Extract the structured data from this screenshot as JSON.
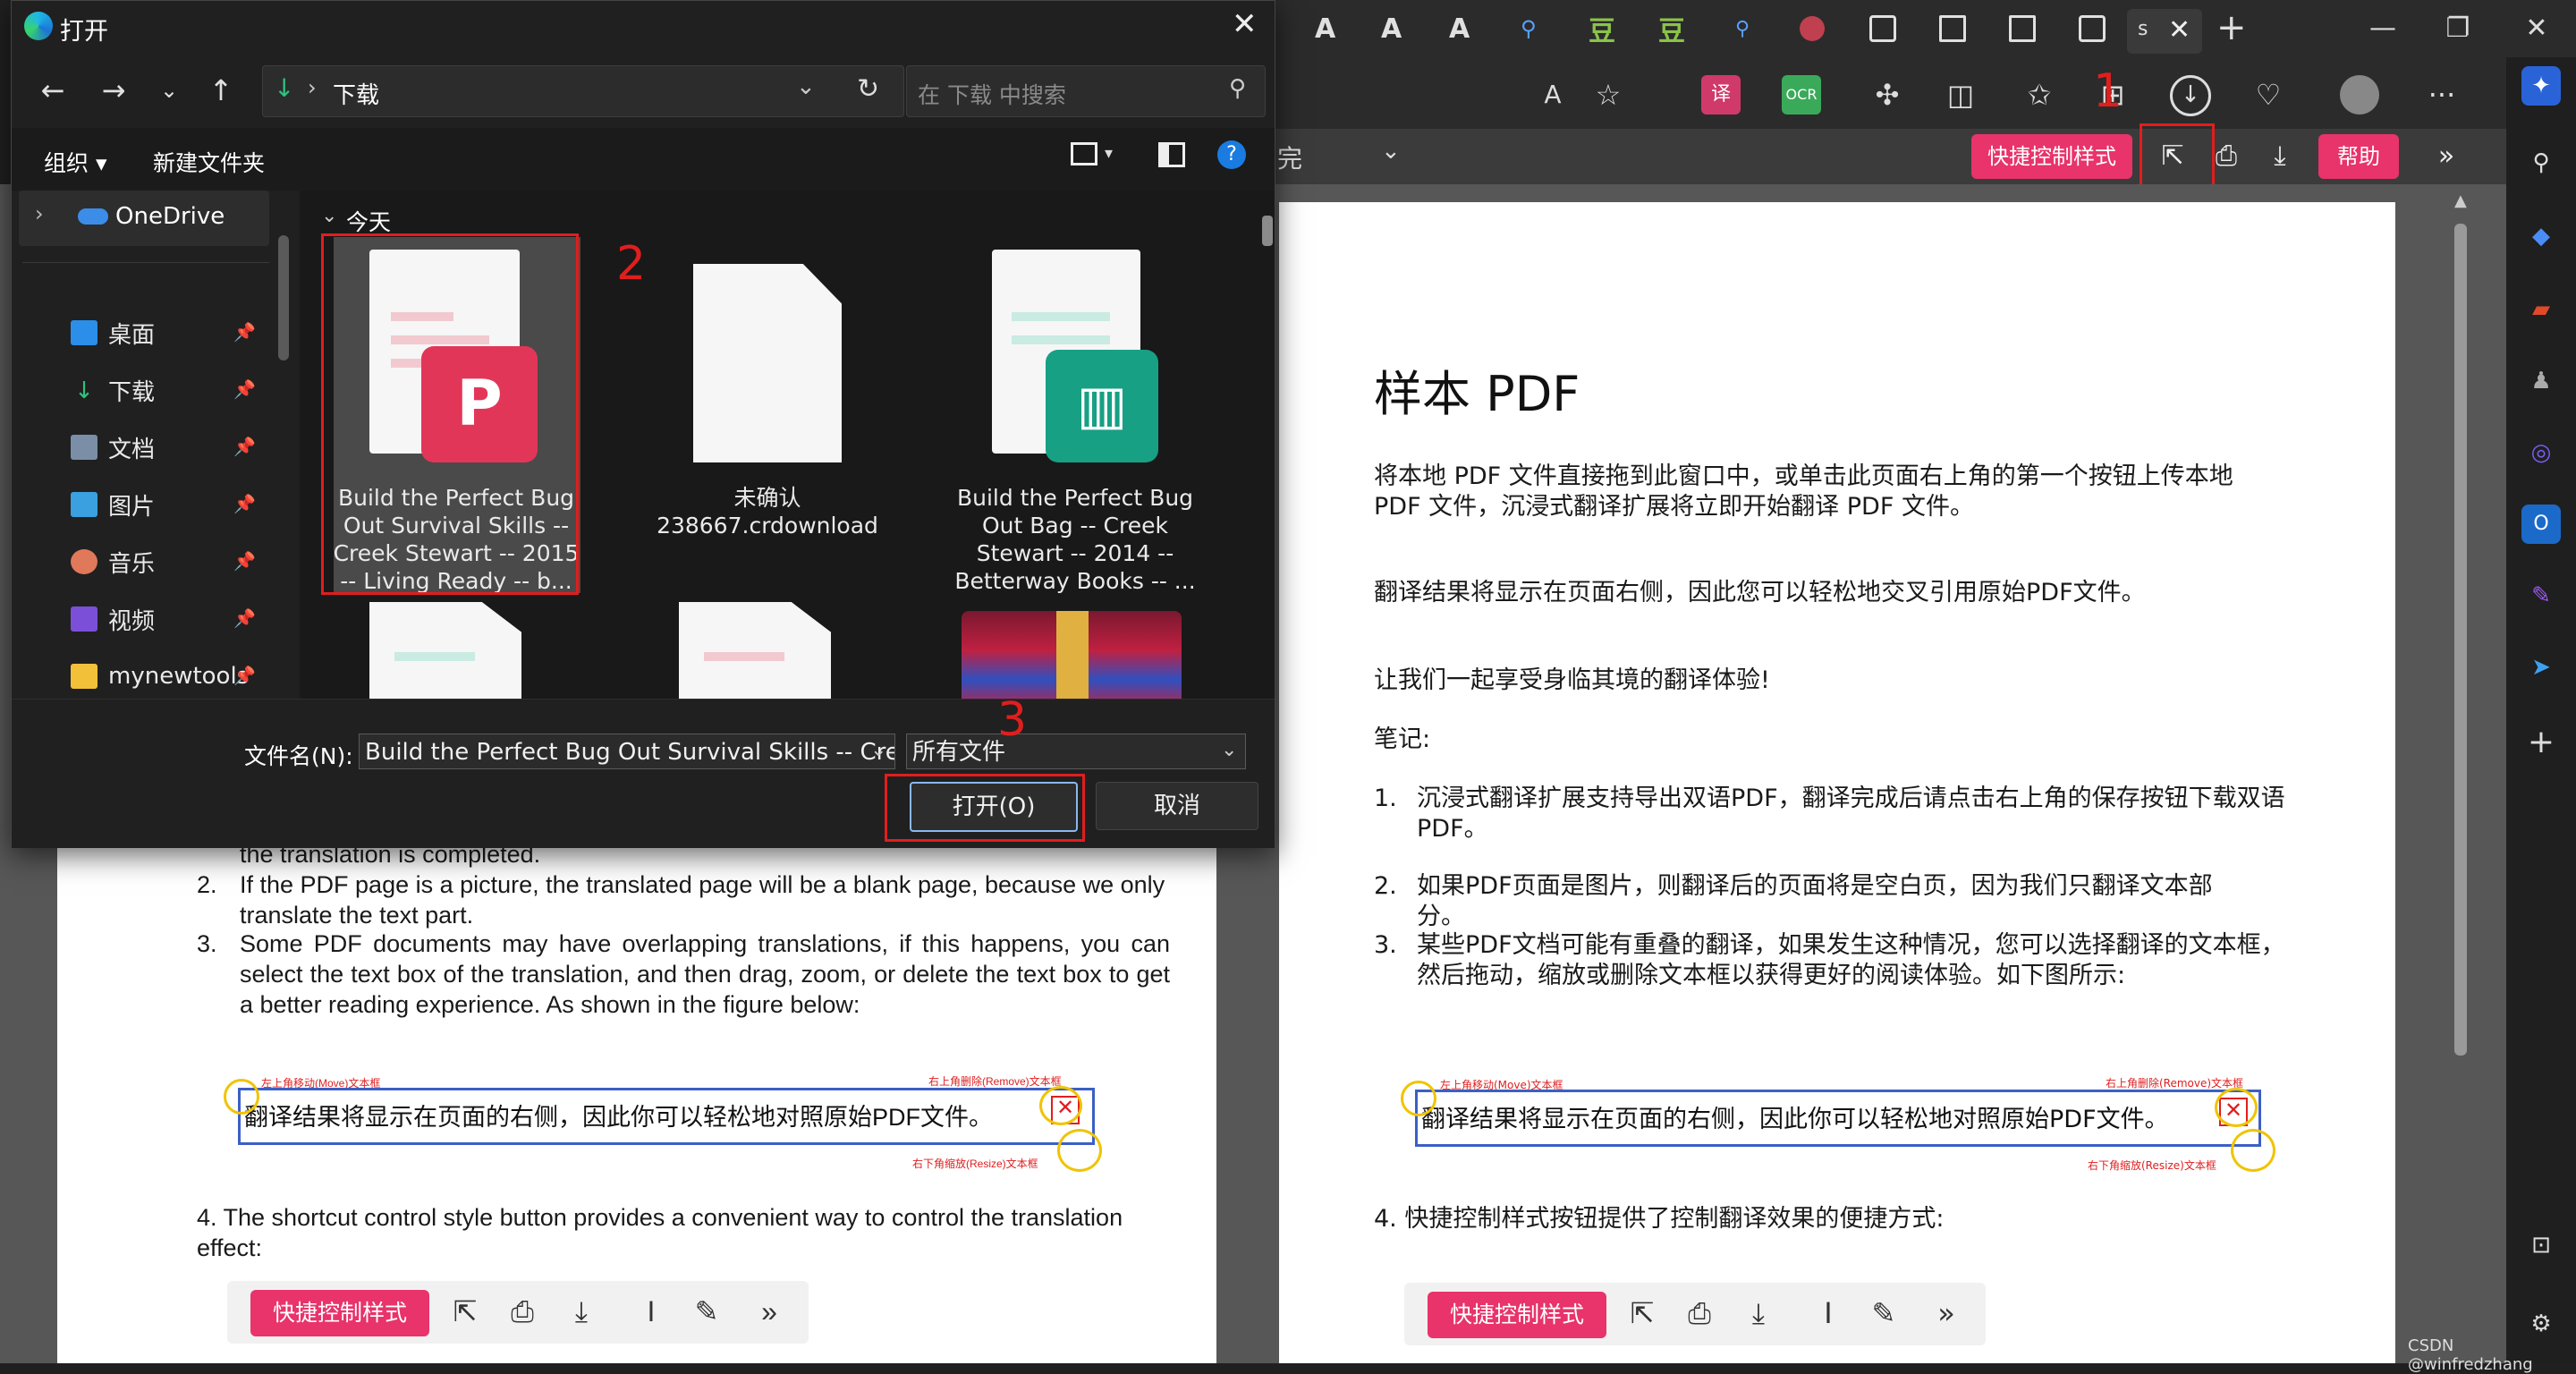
{
  "dialog": {
    "title": "打开",
    "path_label": "下载",
    "search_placeholder": "在 下载 中搜索",
    "cmd": {
      "organize": "组织 ▾",
      "new_folder": "新建文件夹"
    },
    "nav": [
      {
        "label": "OneDrive"
      },
      {
        "label": "桌面"
      },
      {
        "label": "下载"
      },
      {
        "label": "文档"
      },
      {
        "label": "图片"
      },
      {
        "label": "音乐"
      },
      {
        "label": "视频"
      },
      {
        "label": "mynewtools"
      }
    ],
    "group_header": "今天",
    "files": [
      {
        "name": "Build the Perfect Bug Out Survival Skills -- Creek Stewart -- 2015 -- Living Ready -- b..."
      },
      {
        "name": "未确认 238667.crdownload"
      },
      {
        "name": "Build the Perfect Bug Out Bag -- Creek Stewart -- 2014 -- Betterway Books -- ..."
      }
    ],
    "filename_label": "文件名(N):",
    "filename_value": "Build the Perfect Bug Out Survival Skills -- Creek",
    "filetype_value": "所有文件",
    "open_button": "打开(O)",
    "cancel_button": "取消"
  },
  "annotations": {
    "one": "1",
    "two": "2",
    "three": "3"
  },
  "browser": {
    "tab_label": "s",
    "viewer_left_text": "完",
    "shortcut_button": "快捷控制样式",
    "help_button": "帮助"
  },
  "left_pdf": {
    "line0": "the translation is completed.",
    "item2": "If the PDF page is a picture, the translated page will be a blank page, because we only translate the text part.",
    "item3": "Some PDF documents may have overlapping translations, if this happens, you can select the text box of the translation, and then drag, zoom, or delete the text box to get a better reading experience. As shown in the figure below:",
    "demo_text": "翻译结果将显示在页面的右侧，因此你可以轻松地对照原始PDF文件。",
    "demo_move": "左上角移动(Move)文本框",
    "demo_remove": "右上角删除(Remove)文本框",
    "demo_resize": "右下角缩放(Resize)文本框",
    "item4": "4.  The shortcut control style button provides a convenient way to control the translation effect:",
    "shortcut_button": "快捷控制样式"
  },
  "right_pdf": {
    "title": "样本 PDF",
    "p1": "将本地 PDF 文件直接拖到此窗口中，或单击此页面右上角的第一个按钮上传本地 PDF 文件，沉浸式翻译扩展将立即开始翻译 PDF 文件。",
    "p2": "翻译结果将显示在页面右侧，因此您可以轻松地交叉引用原始PDF文件。",
    "p3": "让我们一起享受身临其境的翻译体验!",
    "notes": "笔记:",
    "n1": "沉浸式翻译扩展支持导出双语PDF，翻译完成后请点击右上角的保存按钮下载双语PDF。",
    "n2": "如果PDF页面是图片，则翻译后的页面将是空白页，因为我们只翻译文本部分。",
    "n3": "某些PDF文档可能有重叠的翻译，如果发生这种情况，您可以选择翻译的文本框，然后拖动，缩放或删除文本框以获得更好的阅读体验。如下图所示:",
    "demo_text": "翻译结果将显示在页面的右侧，因此你可以轻松地对照原始PDF文件。",
    "demo_move": "左上角移动(Move)文本框",
    "demo_remove": "右上角删除(Remove)文本框",
    "demo_resize": "右下角缩放(Resize)文本框",
    "n4": "4. 快捷控制样式按钮提供了控制翻译效果的便捷方式:",
    "shortcut_button": "快捷控制样式"
  },
  "watermark": "CSDN @winfredzhang",
  "colors": {
    "accent_pink": "#e8336b",
    "annotation_red": "#e01e1e",
    "dialog_bg": "#202020"
  }
}
